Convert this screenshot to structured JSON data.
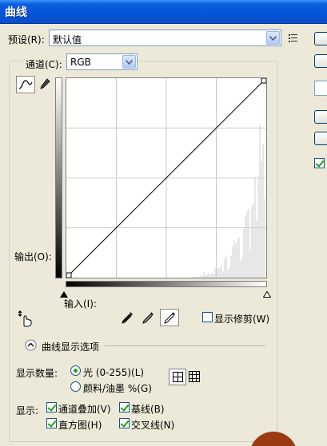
{
  "window": {
    "title": "曲线"
  },
  "preset": {
    "label": "预设(R):",
    "value": "默认值"
  },
  "channel": {
    "label": "通道(C):",
    "value": "RGB"
  },
  "curve": {
    "output_label": "输出(O):",
    "input_label": "输入(I):",
    "input_range": [
      0,
      255
    ],
    "output_range": [
      0,
      255
    ],
    "points": [
      [
        0,
        0
      ],
      [
        255,
        255
      ]
    ]
  },
  "show_clipping": {
    "label": "显示修剪(W)",
    "checked": false
  },
  "display_options": {
    "header": "曲线显示选项",
    "amount_label": "显示数量:",
    "light_label": "光 (0-255)(L)",
    "pigment_label": "颜料/油墨 %(G)",
    "light_selected": true,
    "show_label": "显示:",
    "channel_overlays": "通道叠加(V)",
    "baseline": "基线(B)",
    "histogram": "直方图(H)",
    "intersection": "交叉线(N)"
  },
  "colors": {
    "titlebar": "#0654d8",
    "dialog_bg": "#ece9d8",
    "checkmark": "#21a121"
  }
}
